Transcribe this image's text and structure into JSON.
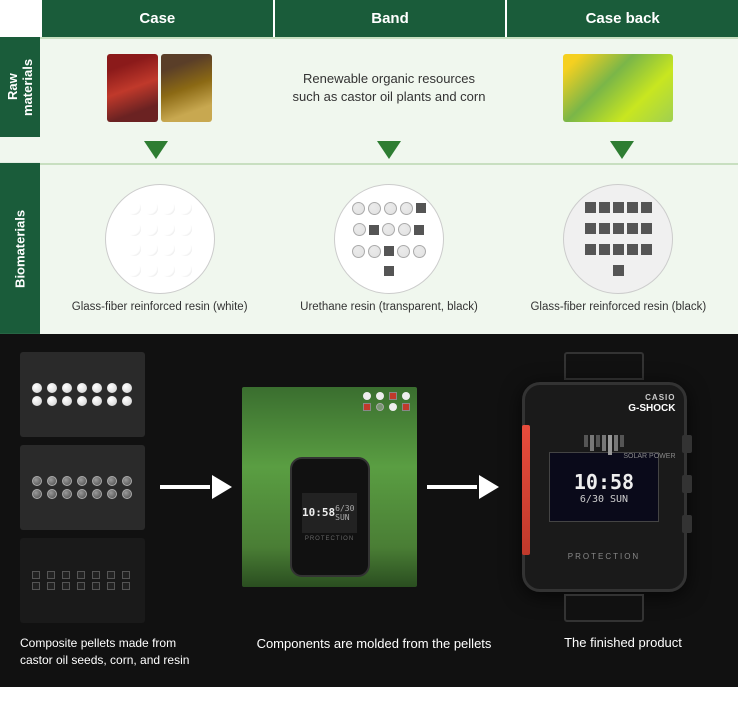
{
  "header": {
    "case_label": "Case",
    "band_label": "Band",
    "caseback_label": "Case back"
  },
  "rows": {
    "raw_materials": {
      "label": "Raw\nmaterials",
      "band_text": "Renewable organic resources\nsuch as castor oil plants and corn"
    },
    "biomaterials": {
      "label": "Biomaterials",
      "case_bio_label": "Glass-fiber reinforced resin (white)",
      "band_bio_label": "Urethane resin (transparent, black)",
      "caseback_bio_label": "Glass-fiber reinforced resin (black)"
    }
  },
  "bottom": {
    "caption_left": "Composite pellets made from\ncastor oil seeds, corn, and resin",
    "caption_center": "Components are\nmolded from the pellets",
    "caption_right": "The finished product",
    "watch_time": "10:58",
    "watch_date": "6/30 SUN"
  }
}
